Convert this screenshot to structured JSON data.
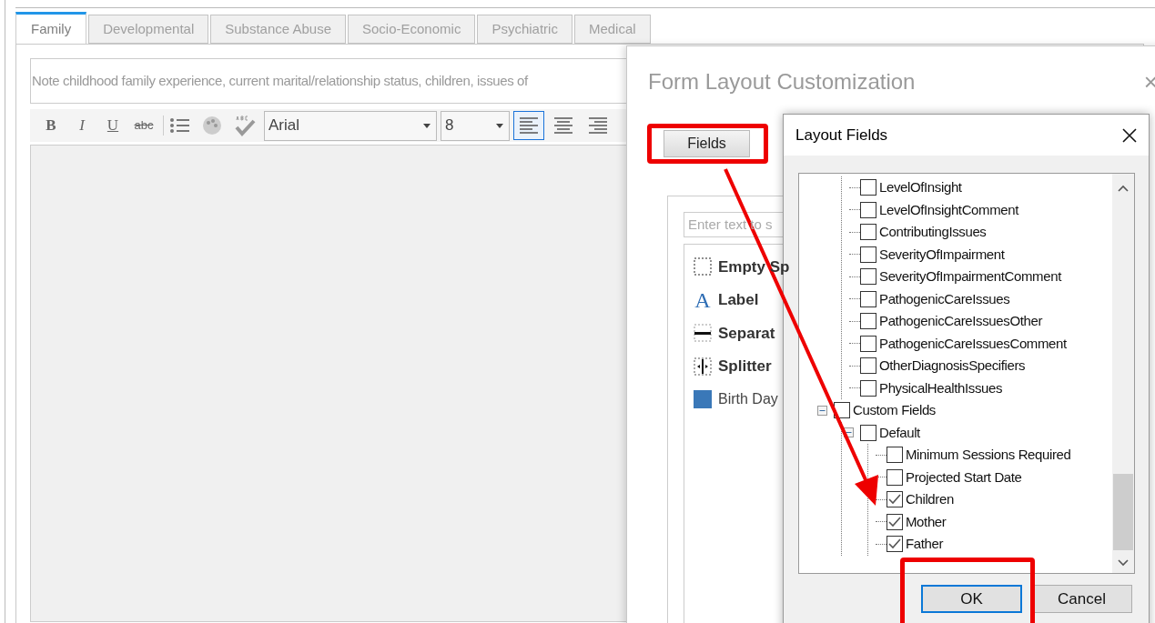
{
  "left_form": {
    "tabs": [
      {
        "label": "Family",
        "selected": true
      },
      {
        "label": "Developmental",
        "selected": false
      },
      {
        "label": "Substance Abuse",
        "selected": false
      },
      {
        "label": "Socio-Economic",
        "selected": false
      },
      {
        "label": "Psychiatric",
        "selected": false
      },
      {
        "label": "Medical",
        "selected": false
      }
    ],
    "note_placeholder": "Note childhood family experience, current marital/relationship status, children, issues of",
    "toolbar": {
      "format_buttons": [
        {
          "kind": "bold",
          "label": "B"
        },
        {
          "kind": "italic",
          "label": "I"
        },
        {
          "kind": "underline",
          "label": "U"
        },
        {
          "kind": "strike",
          "label": "abc"
        }
      ],
      "font": "Arial",
      "size": "8",
      "align_buttons": [
        {
          "kind": "left",
          "selected": true
        },
        {
          "kind": "center",
          "selected": false
        },
        {
          "kind": "right",
          "selected": false
        }
      ]
    }
  },
  "customization_dialog": {
    "title": "Form Layout Customization",
    "close": "×",
    "tabs": [
      {
        "label": "Fields",
        "selected": true
      }
    ],
    "search_placeholder": "Enter text to s",
    "elements": [
      {
        "kind": "empty-space",
        "label": "Empty Sp"
      },
      {
        "kind": "label",
        "glyph": "A",
        "label": "Label"
      },
      {
        "kind": "separator",
        "label": "Separat"
      },
      {
        "kind": "splitter",
        "label": "Splitter"
      },
      {
        "kind": "field",
        "label": "Birth Day"
      }
    ]
  },
  "layout_fields_dialog": {
    "title": "Layout Fields",
    "tree": [
      {
        "children": [
          {
            "label": "LevelOfInsight",
            "checked": false
          },
          {
            "label": "LevelOfInsightComment",
            "checked": false
          },
          {
            "label": "ContributingIssues",
            "checked": false
          },
          {
            "label": "SeverityOfImpairment",
            "checked": false
          },
          {
            "label": "SeverityOfImpairmentComment",
            "checked": false
          },
          {
            "label": "PathogenicCareIssues",
            "checked": false
          },
          {
            "label": "PathogenicCareIssuesOther",
            "checked": false
          },
          {
            "label": "PathogenicCareIssuesComment",
            "checked": false
          },
          {
            "label": "OtherDiagnosisSpecifiers",
            "checked": false
          },
          {
            "label": "PhysicalHealthIssues",
            "checked": false
          }
        ]
      },
      {
        "label": "Custom Fields",
        "checked": false,
        "expanded": true,
        "children": [
          {
            "label": "Default",
            "checked": false,
            "expanded": true,
            "children": [
              {
                "label": "Minimum Sessions Required",
                "checked": false
              },
              {
                "label": "Projected Start Date",
                "checked": false
              },
              {
                "label": "Children",
                "checked": true
              },
              {
                "label": "Mother",
                "checked": true
              },
              {
                "label": "Father",
                "checked": true
              }
            ]
          }
        ]
      }
    ],
    "buttons": [
      {
        "label": "OK",
        "focused": true
      },
      {
        "label": "Cancel",
        "focused": false
      }
    ]
  }
}
